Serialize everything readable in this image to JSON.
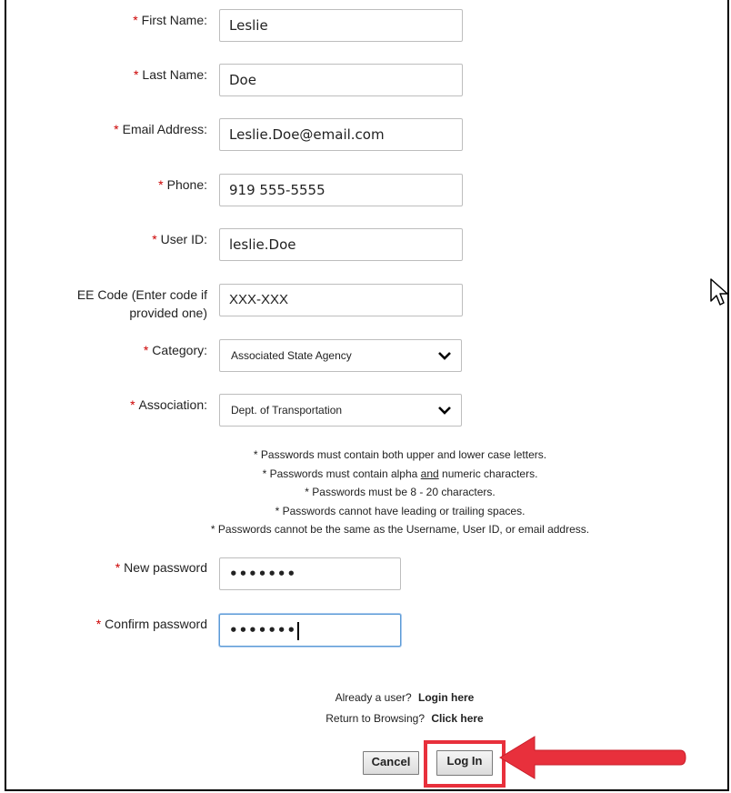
{
  "form": {
    "first_name": {
      "label": "First Name:",
      "value": "Leslie"
    },
    "last_name": {
      "label": "Last Name:",
      "value": "Doe"
    },
    "email": {
      "label": "Email Address:",
      "value": "Leslie.Doe@email.com"
    },
    "phone": {
      "label": "Phone:",
      "value": "919 555-5555"
    },
    "user_id": {
      "label": "User ID:",
      "value": "leslie.Doe"
    },
    "ee_code": {
      "label_line1": "EE Code (Enter code if",
      "label_line2": "provided one)",
      "value": "XXX-XXX"
    },
    "category": {
      "label": "Category:",
      "value": "Associated State Agency"
    },
    "association": {
      "label": "Association:",
      "value": "Dept. of Transportation"
    },
    "new_password": {
      "label": "New password",
      "value": "•••••••"
    },
    "confirm_password": {
      "label": "Confirm password",
      "value": "•••••••"
    },
    "required_marker": "*"
  },
  "password_rules": {
    "rule1": "* Passwords must contain both upper and lower case letters.",
    "rule2_pre": "* Passwords must contain alpha ",
    "rule2_and": "and",
    "rule2_post": " numeric characters.",
    "rule3": "* Passwords must be 8 - 20 characters.",
    "rule4": "* Passwords cannot have leading or trailing spaces.",
    "rule5": "* Passwords cannot be the same as the Username, User ID, or email address."
  },
  "links": {
    "already_user": "Already a user?",
    "login_here": "Login here",
    "return_browsing": "Return to Browsing?",
    "click_here": "Click here"
  },
  "buttons": {
    "cancel": "Cancel",
    "login": "Log In"
  },
  "colors": {
    "required": "#cc0000",
    "annotation_red": "#e8303c",
    "focus_border": "#5b9bd5"
  }
}
